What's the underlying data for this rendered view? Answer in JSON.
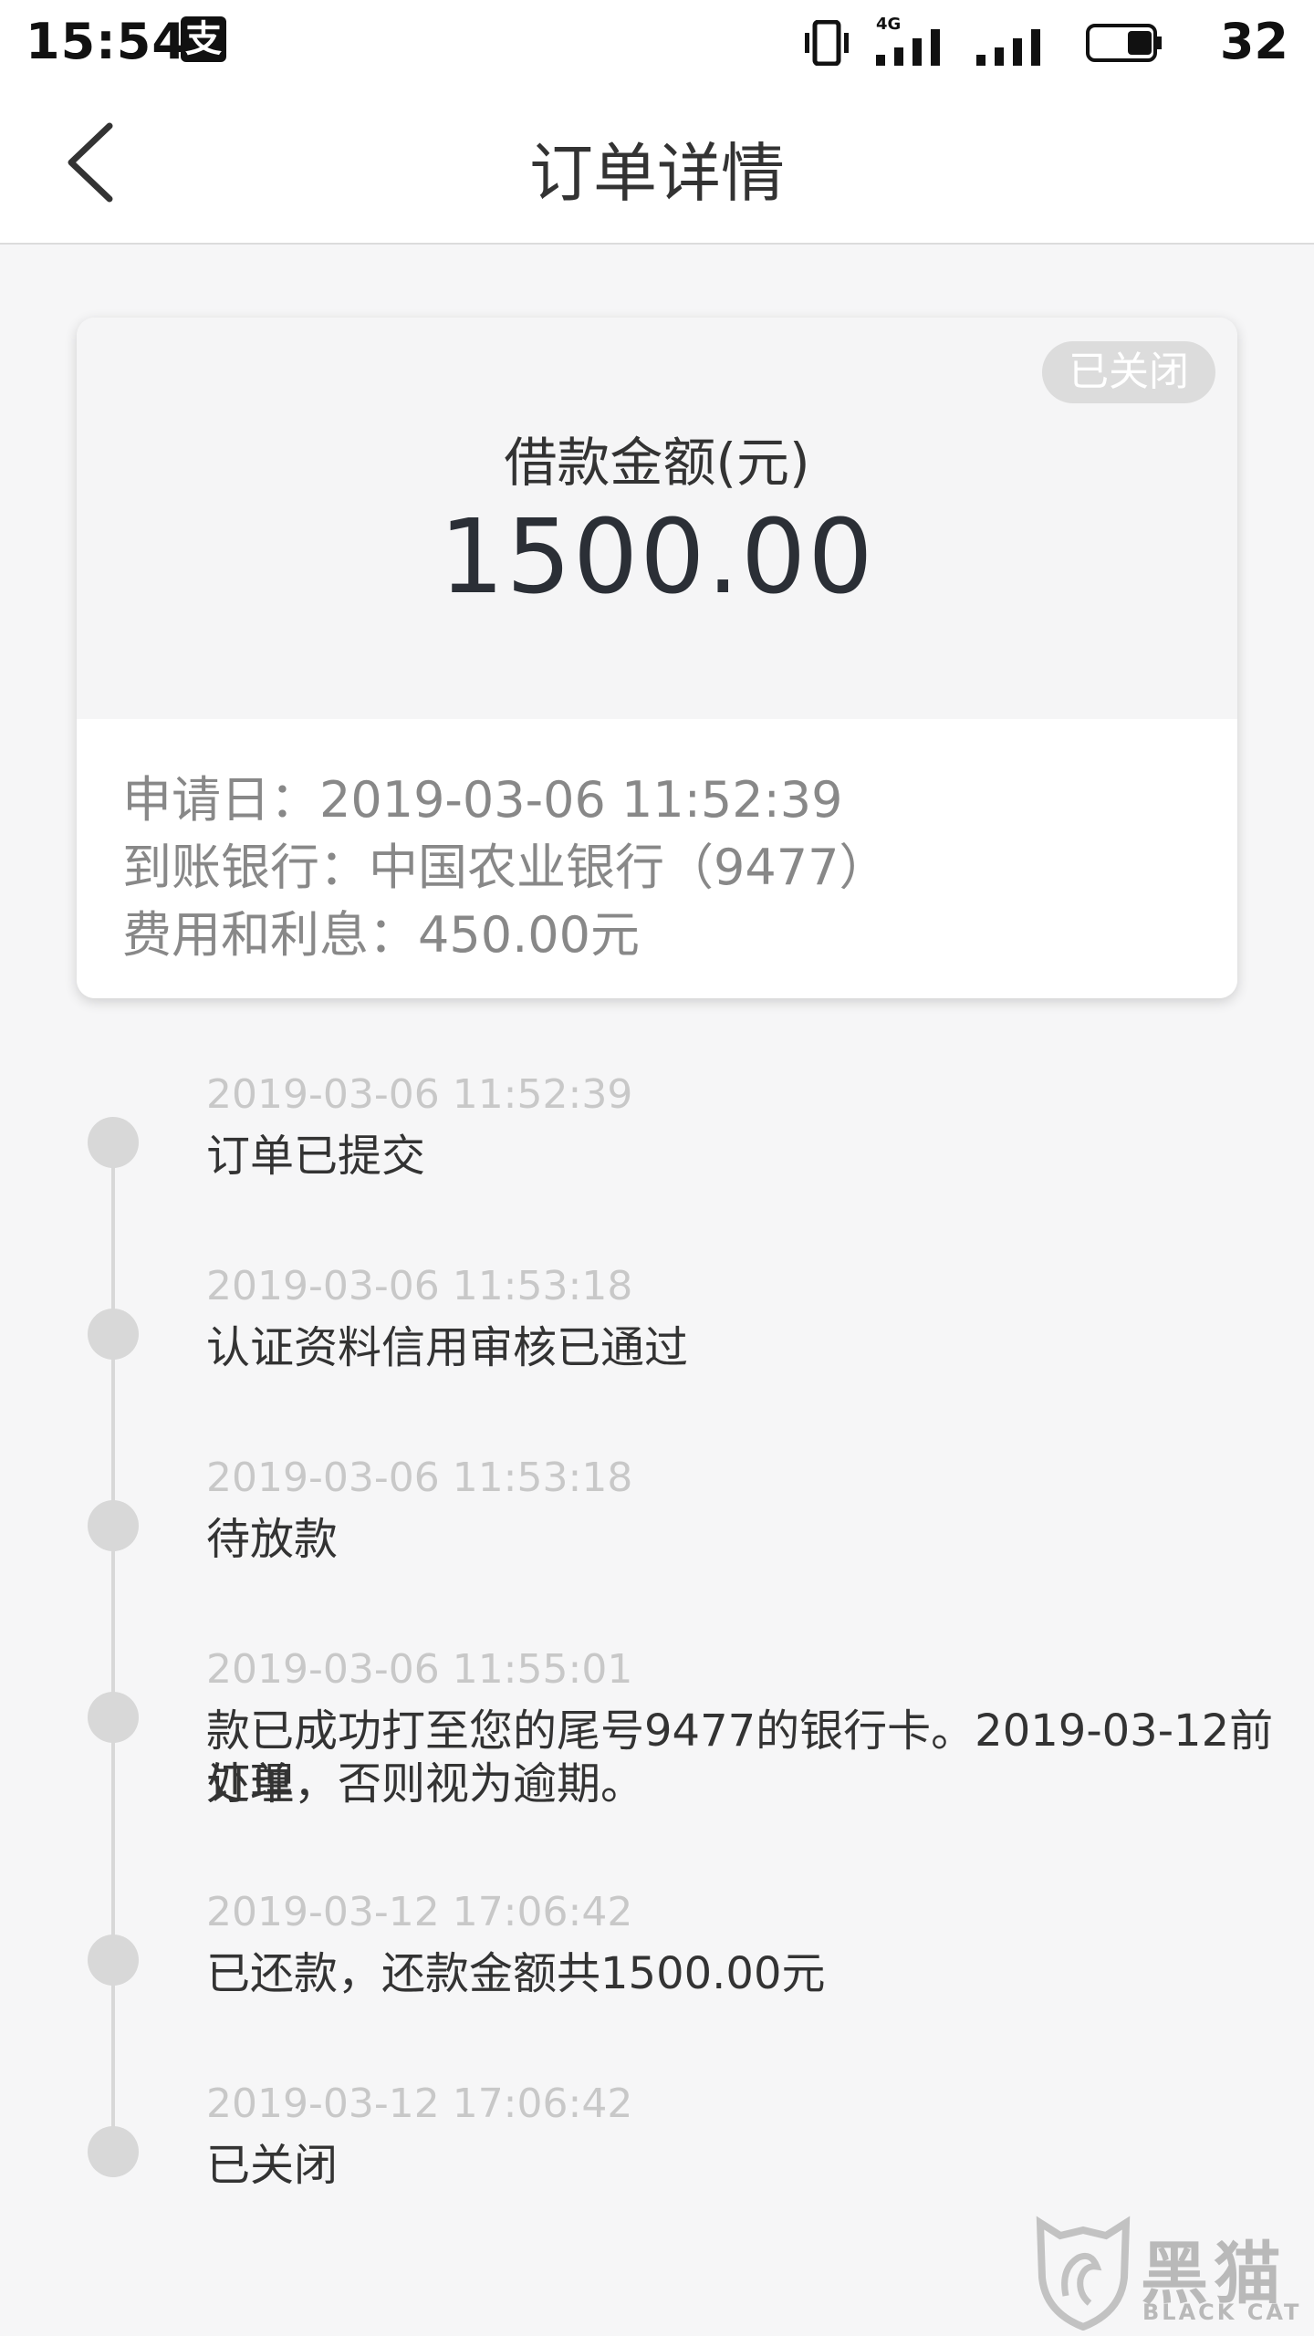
{
  "status_bar": {
    "time": "15:54",
    "alipay_icon": "alipay-icon",
    "network_label": "4G",
    "battery": "32"
  },
  "header": {
    "title": "订单详情",
    "back_icon": "chevron-left-icon"
  },
  "card": {
    "status_badge": "已关闭",
    "amount_label": "借款金额(元)",
    "amount_value": "1500.00",
    "details": [
      {
        "key": "申请日：",
        "value": "2019-03-06 11:52:39"
      },
      {
        "key": "到账银行：",
        "value": "中国农业银行（9477）"
      },
      {
        "key": "费用和利息：",
        "value": "450.00元"
      }
    ]
  },
  "timeline": [
    {
      "time": "2019-03-06 11:52:39",
      "text": "订单已提交"
    },
    {
      "time": "2019-03-06 11:53:18",
      "text": "认证资料信用审核已通过"
    },
    {
      "time": "2019-03-06 11:53:18",
      "text": "待放款"
    },
    {
      "time": "2019-03-06 11:55:01",
      "text": "款已成功打至您的尾号9477的银行卡。2019-03-12前处理",
      "text2": "订单，否则视为逾期。"
    },
    {
      "time": "2019-03-12 17:06:42",
      "text": "已还款，还款金额共1500.00元"
    },
    {
      "time": "2019-03-12 17:06:42",
      "text": "已关闭"
    }
  ],
  "watermark": {
    "title": "黑猫",
    "subtitle": "BLACK CAT"
  },
  "colors": {
    "background": "#f6f6f7",
    "badge": "#dcdcdc",
    "timeline": "#d8d8d8",
    "muted_text": "#c8c8c8"
  }
}
